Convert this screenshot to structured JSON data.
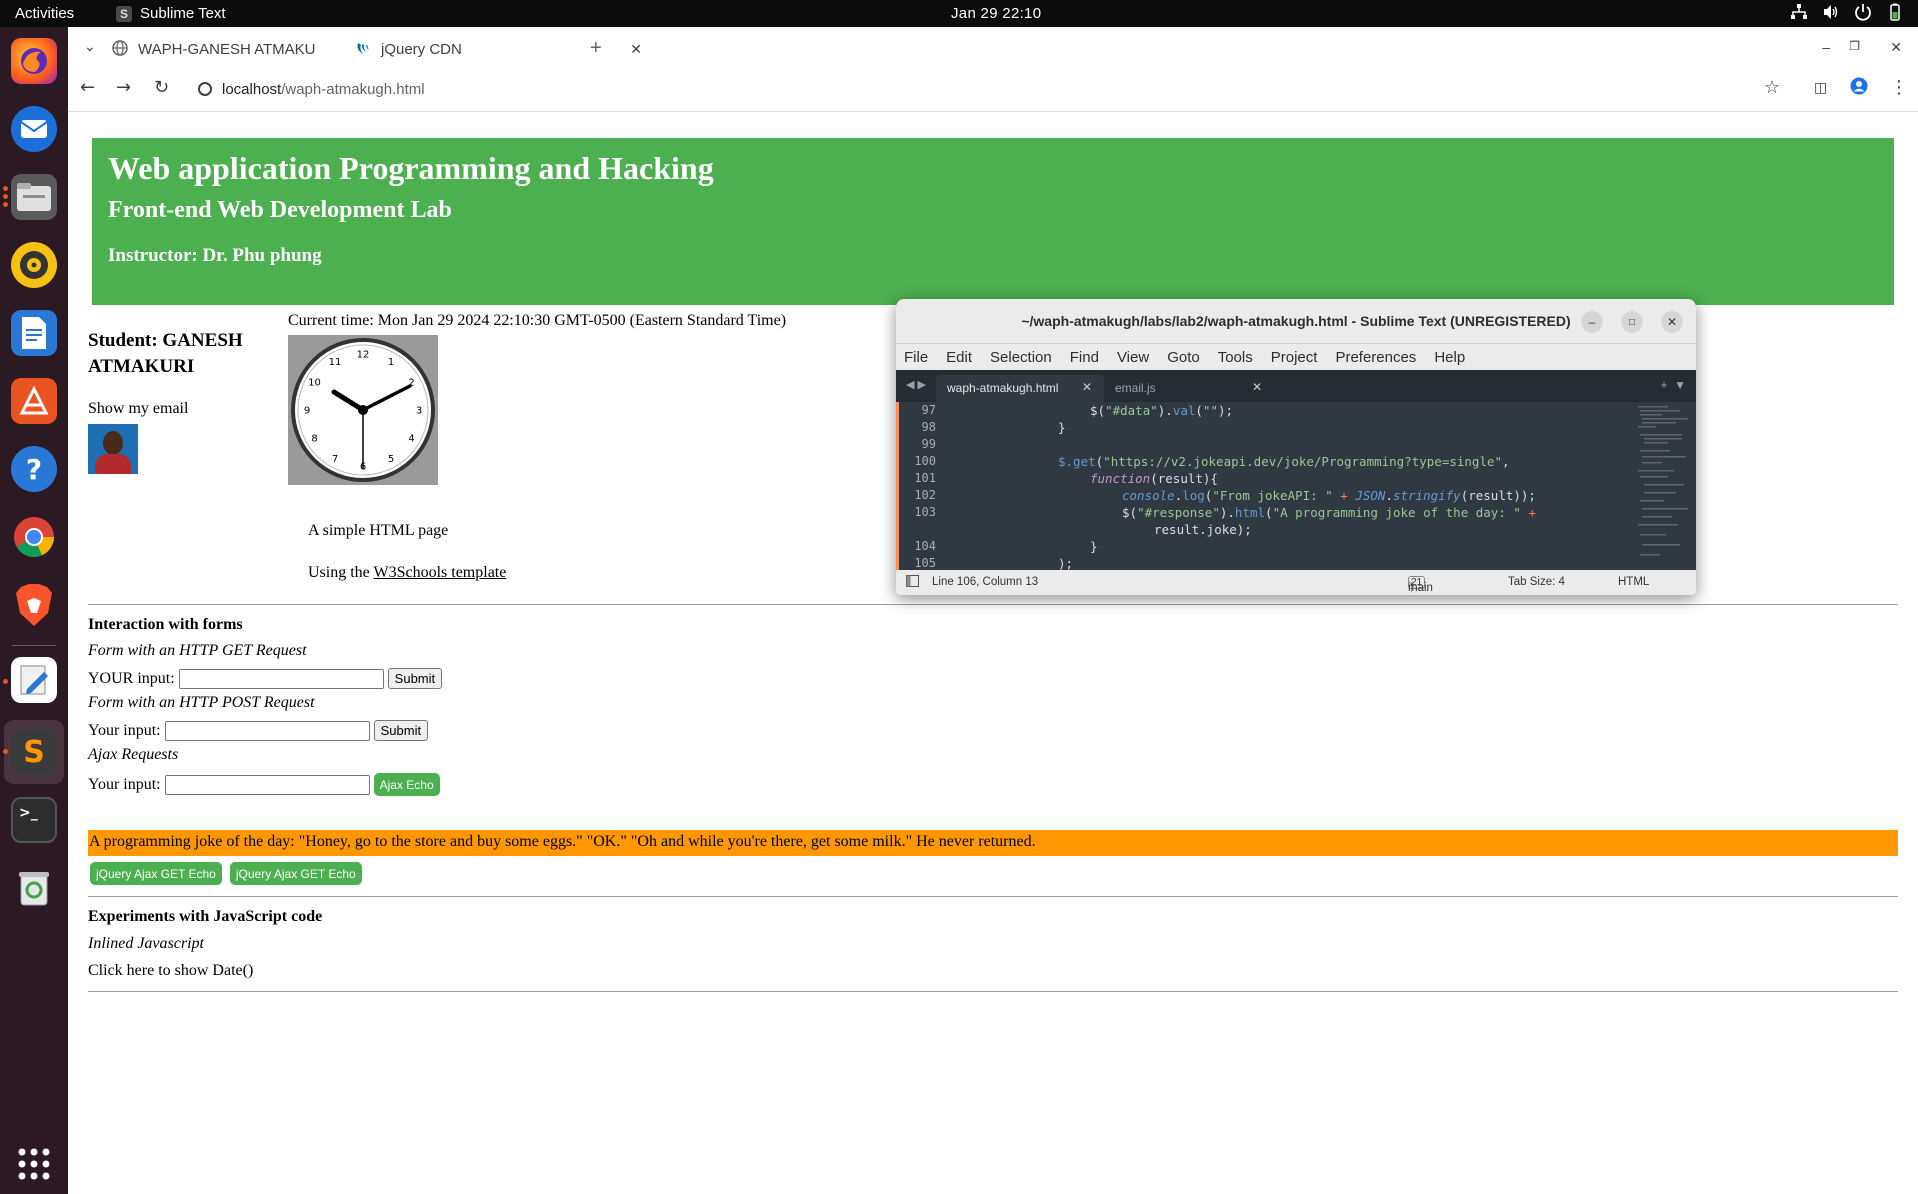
{
  "topbar": {
    "activities": "Activities",
    "app_name": "Sublime Text",
    "clock": "Jan 29  22:10"
  },
  "dock": {
    "items": [
      "firefox-icon",
      "thunderbird-icon",
      "files-icon",
      "rhythmbox-icon",
      "libreoffice-writer-icon",
      "app-center-icon",
      "help-icon",
      "chrome-icon",
      "brave-icon",
      "text-editor-icon",
      "sublime-text-icon",
      "terminal-icon",
      "trash-icon",
      "show-apps-icon"
    ]
  },
  "browser": {
    "tabs": [
      {
        "title": "WAPH-GANESH ATMAKU"
      },
      {
        "title": "jQuery CDN"
      }
    ],
    "url_host": "localhost",
    "url_path": "/waph-atmakugh.html"
  },
  "page": {
    "header": {
      "title": "Web application Programming and Hacking",
      "subtitle": "Front-end Web Development Lab",
      "instructor": "Instructor: Dr. Phu phung"
    },
    "student": "Student: GANESH ATMAKURI",
    "show_email": "Show my email",
    "current_time": "Current time: Mon Jan 29 2024 22:10:30 GMT-0500 (Eastern Standard Time)",
    "clock_numbers": [
      "12",
      "1",
      "2",
      "3",
      "4",
      "5",
      "6",
      "7",
      "8",
      "9",
      "10",
      "11"
    ],
    "simple_page": "A simple HTML page",
    "using_prefix": "Using the ",
    "using_link": "W3Schools template",
    "forms": {
      "title": "Interaction with forms",
      "get_caption": "Form with an HTTP GET Request",
      "get_label": "YOUR input:",
      "get_submit": "Submit",
      "post_caption": "Form with an HTTP POST Request",
      "post_label": "Your input:",
      "post_submit": "Submit",
      "ajax_caption": "Ajax Requests",
      "ajax_label": "Your input:",
      "ajax_button": "Ajax Echo",
      "joke": "A programming joke of the day: \"Honey, go to the store and buy some eggs.\" \"OK.\" \"Oh and while you're there, get some milk.\" He never returned.",
      "jquery_get_1": "jQuery Ajax GET Echo",
      "jquery_get_2": "jQuery Ajax GET Echo"
    },
    "experiments": {
      "title": "Experiments with JavaScript code",
      "inline_caption": "Inlined Javascript",
      "show_date": "Click here to show Date()"
    }
  },
  "sublime": {
    "title": "~/waph-atmakugh/labs/lab2/waph-atmakugh.html - Sublime Text (UNREGISTERED)",
    "menu": [
      "File",
      "Edit",
      "Selection",
      "Find",
      "View",
      "Goto",
      "Tools",
      "Project",
      "Preferences",
      "Help"
    ],
    "tabs": [
      "waph-atmakugh.html",
      "email.js"
    ],
    "line_numbers": [
      "97",
      "98",
      "99",
      "100",
      "101",
      "102",
      "103",
      "",
      "104",
      "105"
    ],
    "code": {
      "l97_a": "$(",
      "l97_b": "\"#data\"",
      "l97_c": ").",
      "l97_d": "val",
      "l97_e": "(",
      "l97_f": "\"\"",
      "l97_g": ");",
      "l98": "}",
      "l100_a": "$.get",
      "l100_b": "(",
      "l100_c": "\"https://v2.jokeapi.dev/joke/Programming?type=single\"",
      "l100_d": ",",
      "l101_a": "function",
      "l101_b": "(result){",
      "l102_a": "console",
      "l102_b": ".",
      "l102_c": "log",
      "l102_d": "(",
      "l102_e": "\"From jokeAPI: \"",
      "l102_f": " + ",
      "l102_g": "JSON",
      "l102_h": ".",
      "l102_i": "stringify",
      "l102_j": "(result));",
      "l103_a": "$(",
      "l103_b": "\"#response\"",
      "l103_c": ").",
      "l103_d": "html",
      "l103_e": "(",
      "l103_f": "\"A programming joke of the day: \"",
      "l103_g": " +",
      "l103_cont": "result.joke);",
      "l104": "}",
      "l105": ");"
    },
    "status": {
      "position": "Line 106, Column 13",
      "branch": "main",
      "branch_count": "21",
      "tab_size": "Tab Size: 4",
      "syntax": "HTML"
    }
  }
}
